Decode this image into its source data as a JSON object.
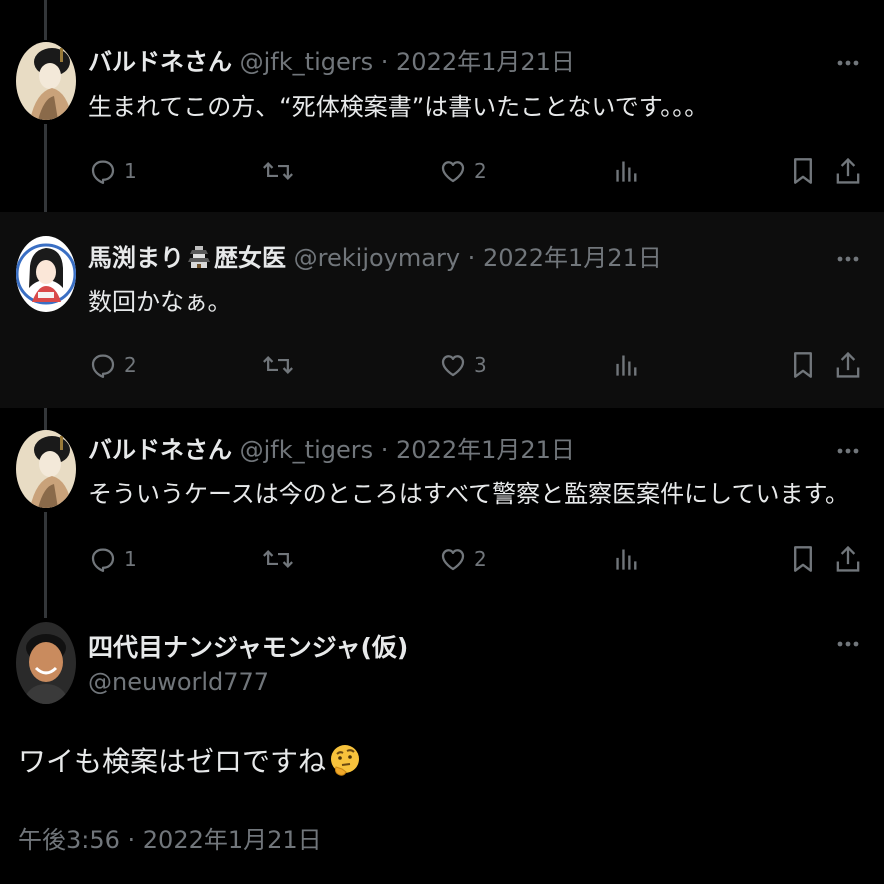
{
  "colors": {
    "background": "#000000",
    "text": "#e7e9ea",
    "muted": "#71767b",
    "thread_line": "#333639"
  },
  "tweets": [
    {
      "name": "バルドネさん",
      "handle": "@jfk_tigers",
      "separator": "·",
      "date": "2022年1月21日",
      "text": "生まれてこの方、“死体検案書”は書いたことないです。。。",
      "replies": "1",
      "retweets": "",
      "likes": "2"
    },
    {
      "name_a": "馬渕まり",
      "name_b": "歴女医",
      "name_emoji": "castle-icon",
      "handle": "@rekijoymary",
      "separator": "·",
      "date": "2022年1月21日",
      "text": "数回かなぁ。",
      "replies": "2",
      "retweets": "",
      "likes": "3"
    },
    {
      "name": "バルドネさん",
      "handle": "@jfk_tigers",
      "separator": "·",
      "date": "2022年1月21日",
      "text": "そういうケースは今のところはすべて警察と監察医案件にしています。",
      "replies": "1",
      "retweets": "",
      "likes": "2"
    }
  ],
  "main_tweet": {
    "name": "四代目ナンジャモンジャ(仮)",
    "handle": "@neuworld777",
    "text": "ワイも検案はゼロですね",
    "emoji": "thinking-face-emoji",
    "timestamp": "午後3:56 · 2022年1月21日"
  }
}
